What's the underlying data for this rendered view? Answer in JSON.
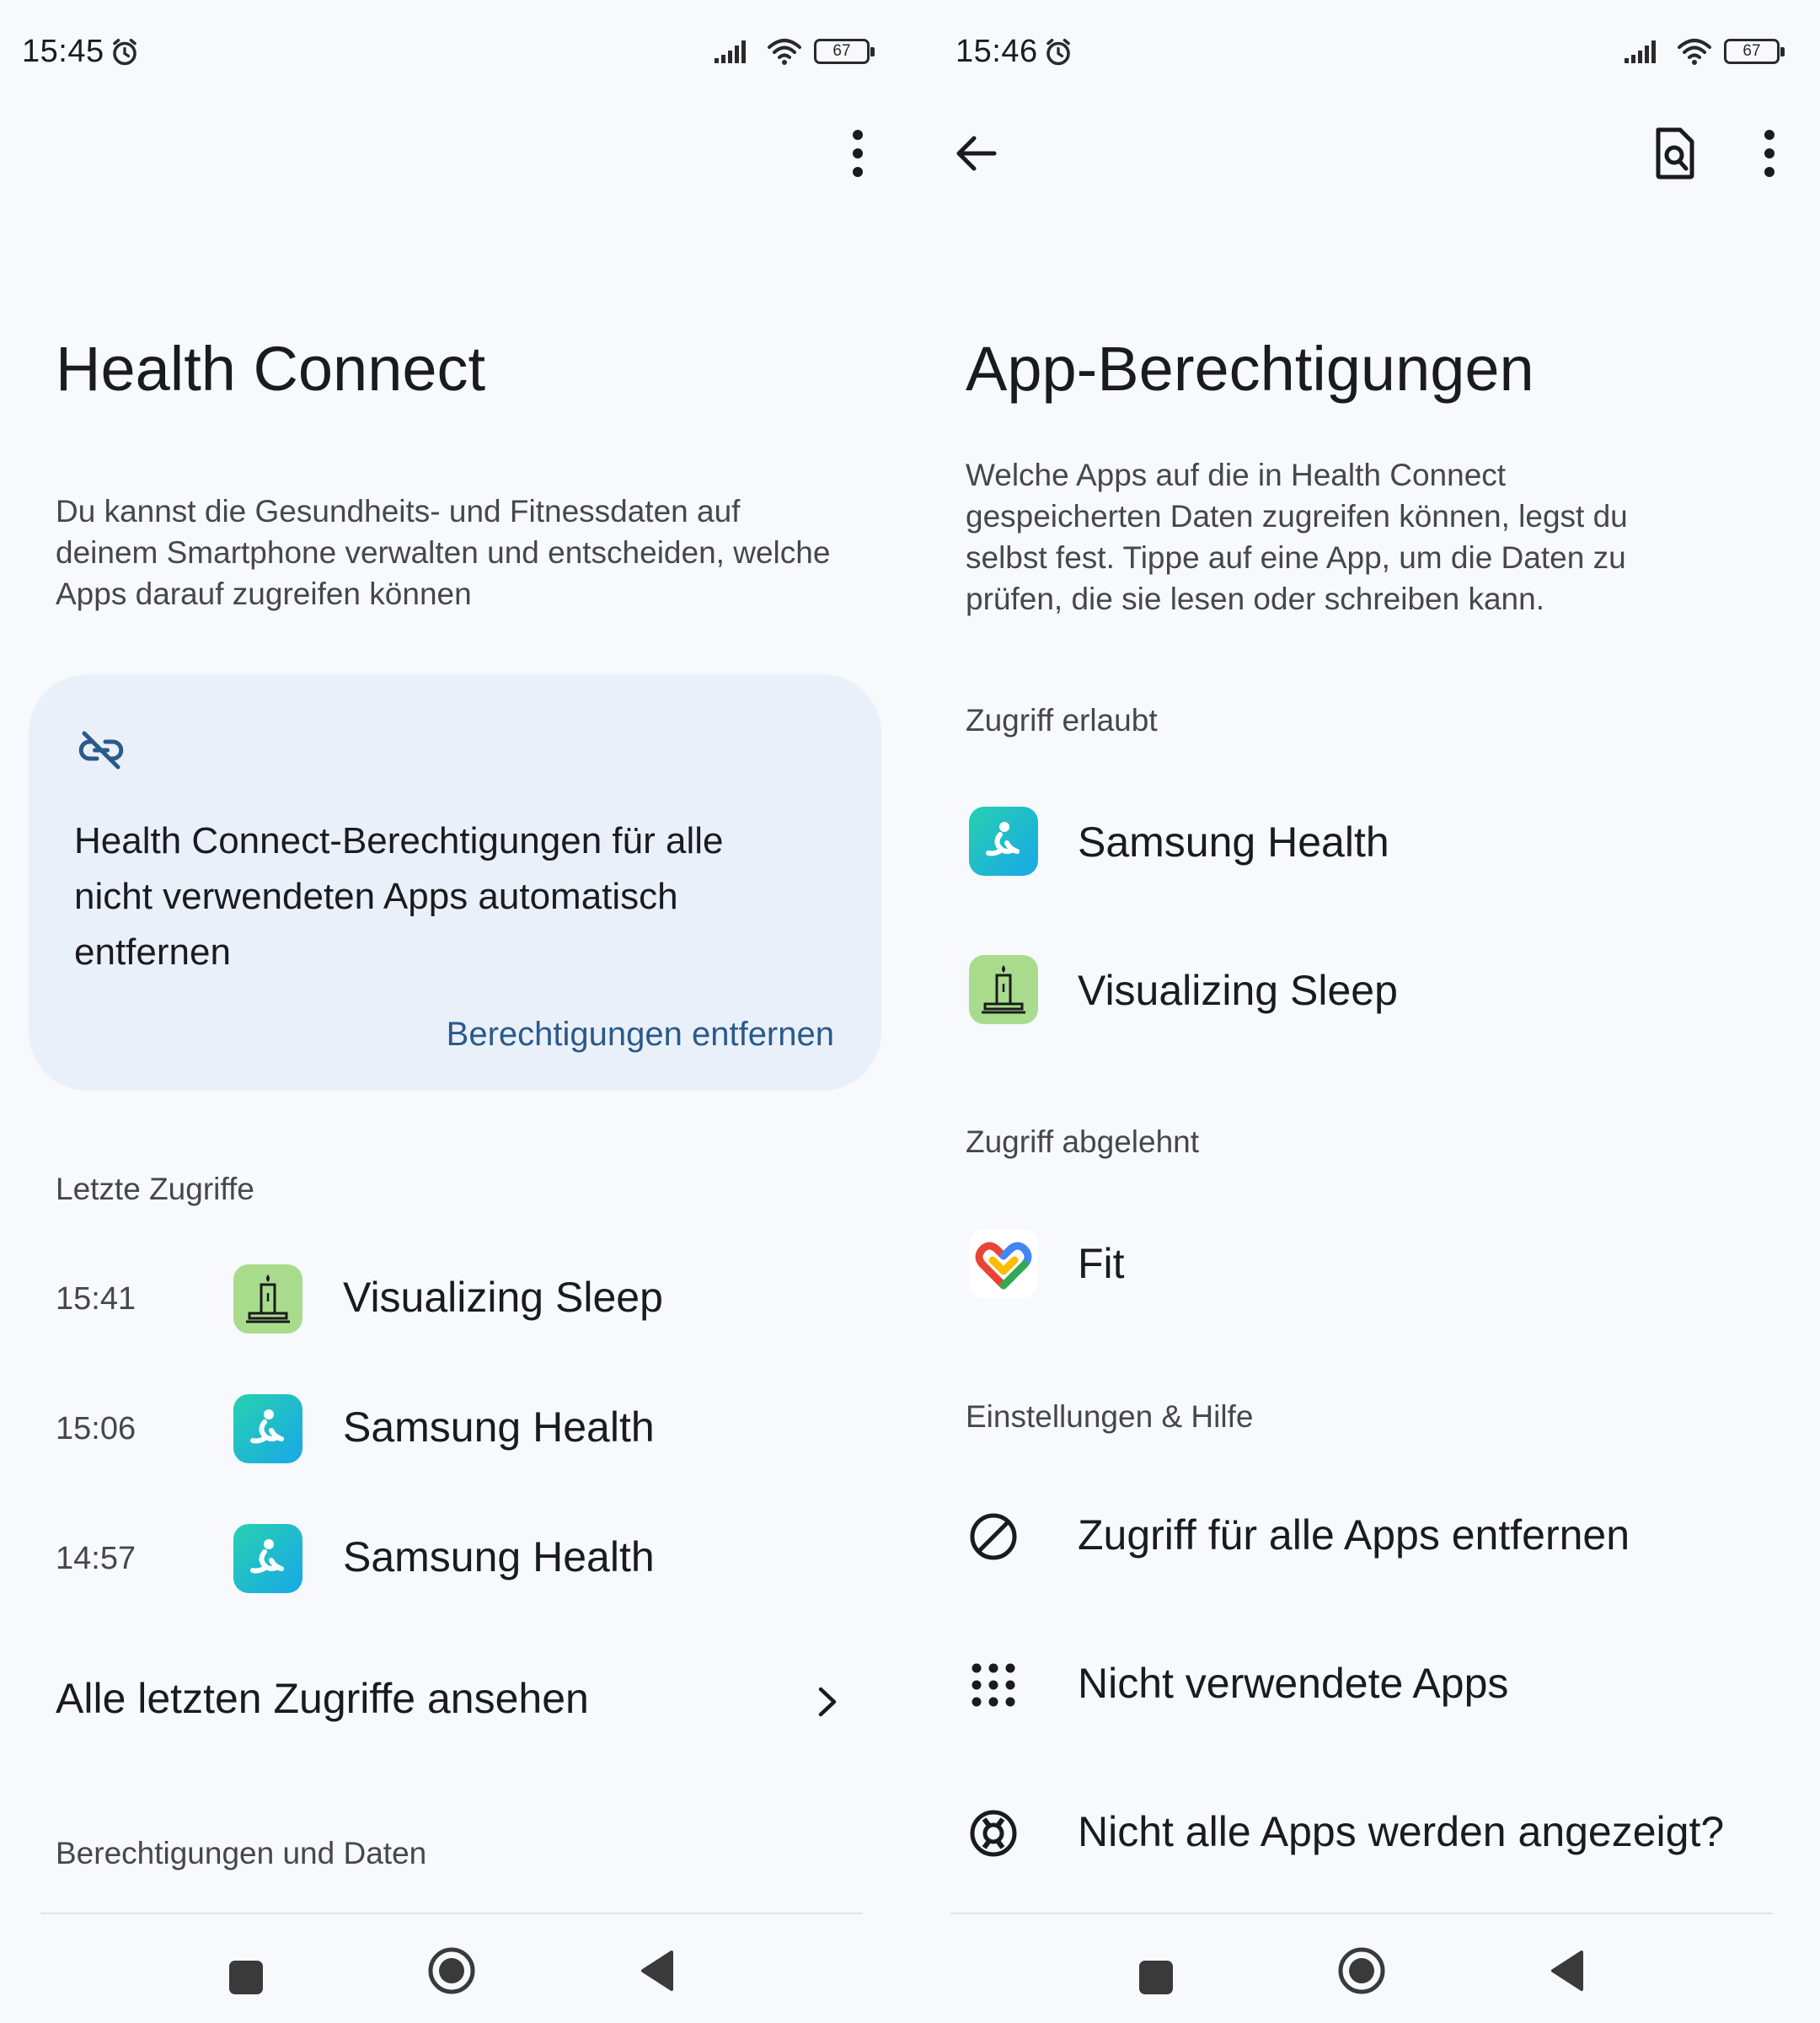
{
  "left": {
    "status": {
      "time": "15:45",
      "battery": "67"
    },
    "title": "Health Connect",
    "description": "Du kannst die Gesundheits- und Fitnessdaten auf deinem Smartphone verwalten und entscheiden, welche Apps darauf zugreifen können",
    "card": {
      "text": "Health Connect-Berechtigungen für alle nicht verwendeten Apps automatisch entfernen",
      "action": "Berechtigungen entfernen"
    },
    "recent_section": "Letzte Zugriffe",
    "recent": [
      {
        "time": "15:41",
        "app": "Visualizing Sleep",
        "icon": "visualizing-sleep-icon"
      },
      {
        "time": "15:06",
        "app": "Samsung Health",
        "icon": "samsung-health-icon"
      },
      {
        "time": "14:57",
        "app": "Samsung Health",
        "icon": "samsung-health-icon"
      }
    ],
    "see_all": "Alle letzten Zugriffe ansehen",
    "permissions_section": "Berechtigungen und Daten"
  },
  "right": {
    "status": {
      "time": "15:46",
      "battery": "67"
    },
    "title": "App-Berechtigungen",
    "description": "Welche Apps auf die in Health Connect gespeicherten Daten zugreifen können, legst du selbst fest. Tippe auf eine App, um die Daten zu prüfen, die sie lesen oder schreiben kann.",
    "allowed_section": "Zugriff erlaubt",
    "allowed": [
      "Samsung Health",
      "Visualizing Sleep"
    ],
    "denied_section": "Zugriff abgelehnt",
    "denied": [
      "Fit"
    ],
    "settings_section": "Einstellungen & Hilfe",
    "settings": [
      {
        "label": "Zugriff für alle Apps entfernen",
        "icon": "block-icon"
      },
      {
        "label": "Nicht verwendete Apps",
        "icon": "apps-grid-icon"
      },
      {
        "label": "Nicht alle Apps werden angezeigt?",
        "icon": "help-lifebuoy-icon"
      }
    ]
  }
}
